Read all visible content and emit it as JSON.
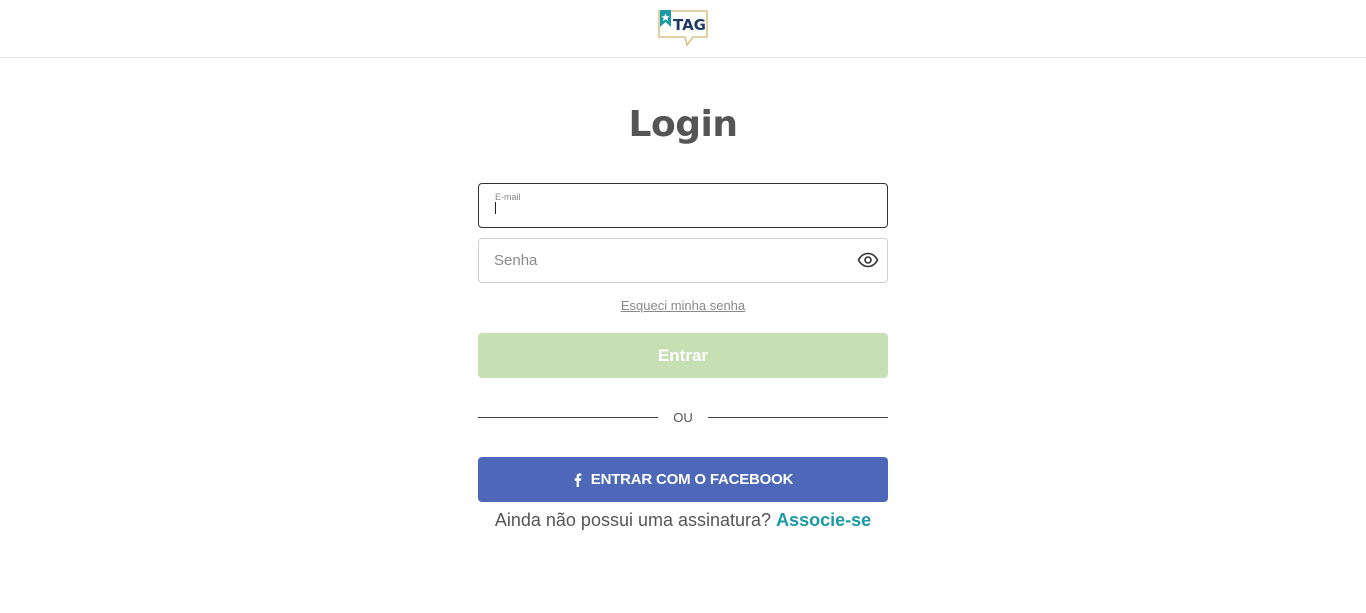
{
  "header": {
    "logo_text": "TAG",
    "logo_icon": "tag-logo-icon"
  },
  "login": {
    "title": "Login",
    "email": {
      "label": "E-mail",
      "value": ""
    },
    "password": {
      "placeholder": "Senha",
      "value": "",
      "toggle_icon": "eye-icon"
    },
    "forgot_link": "Esqueci minha senha",
    "submit_label": "Entrar",
    "divider_text": "OU",
    "facebook_label": "ENTRAR COM O FACEBOOK",
    "facebook_icon": "facebook-icon",
    "signup_prompt": "Ainda não possui uma assinatura?",
    "signup_link": "Associe-se"
  },
  "colors": {
    "submit_disabled": "#c6e0b3",
    "facebook": "#4d68b9",
    "link_accent": "#1a9aa6",
    "logo_gold": "#d8c488",
    "logo_teal": "#1a9aa6",
    "logo_navy": "#1f3b63"
  }
}
